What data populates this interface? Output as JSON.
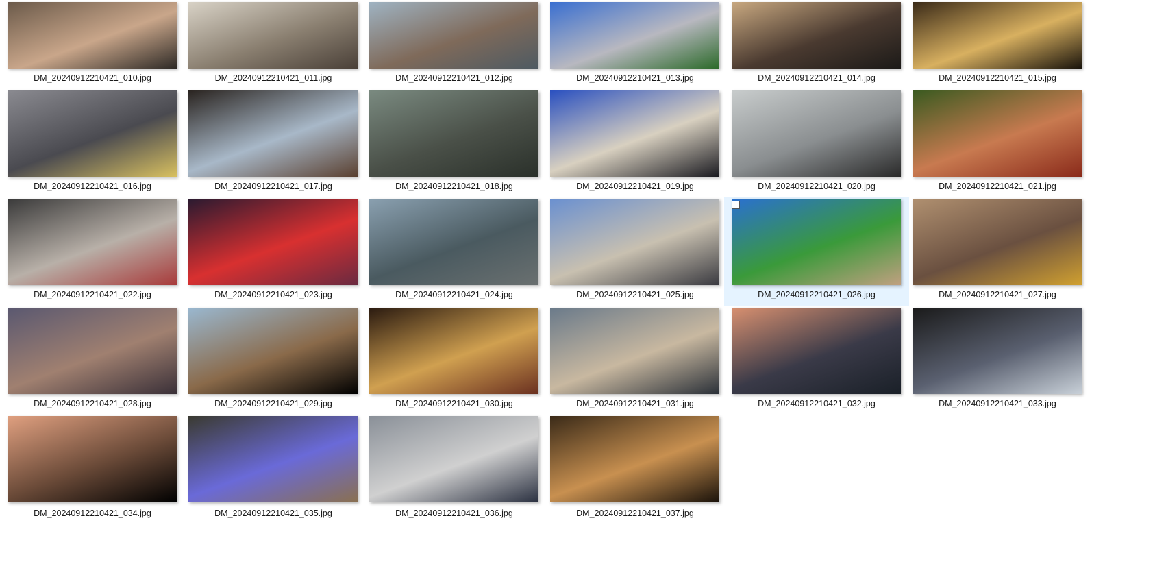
{
  "view": "explorer-large-icons",
  "hovered_index": 16,
  "thumbnail_icon": "image-thumbnail-icon",
  "files": [
    {
      "name": "DM_20240912210421_010.jpg",
      "colors": [
        "#6b5a4a",
        "#c9a68a",
        "#2e2a26"
      ]
    },
    {
      "name": "DM_20240912210421_011.jpg",
      "colors": [
        "#d8d2c6",
        "#8a7f70",
        "#4a4038"
      ]
    },
    {
      "name": "DM_20240912210421_012.jpg",
      "colors": [
        "#9fb3c2",
        "#7f6a5a",
        "#4e5a62"
      ]
    },
    {
      "name": "DM_20240912210421_013.jpg",
      "colors": [
        "#3a6fd0",
        "#b8b8c0",
        "#2c6a2a"
      ]
    },
    {
      "name": "DM_20240912210421_014.jpg",
      "colors": [
        "#c8a880",
        "#4a3a30",
        "#1c1a18"
      ]
    },
    {
      "name": "DM_20240912210421_015.jpg",
      "colors": [
        "#3a2a18",
        "#d8b060",
        "#1a140c"
      ]
    },
    {
      "name": "DM_20240912210421_016.jpg",
      "colors": [
        "#8a8a90",
        "#4a4a50",
        "#d8c060"
      ]
    },
    {
      "name": "DM_20240912210421_017.jpg",
      "colors": [
        "#2a2420",
        "#a8b8c8",
        "#5a4030"
      ]
    },
    {
      "name": "DM_20240912210421_018.jpg",
      "colors": [
        "#7a8a80",
        "#4a5048",
        "#2a302a"
      ]
    },
    {
      "name": "DM_20240912210421_019.jpg",
      "colors": [
        "#2a50c0",
        "#d8d0c0",
        "#1a1a20"
      ]
    },
    {
      "name": "DM_20240912210421_020.jpg",
      "colors": [
        "#c8cccc",
        "#8a8e90",
        "#2a2a2a"
      ]
    },
    {
      "name": "DM_20240912210421_021.jpg",
      "colors": [
        "#3a5a20",
        "#c87a50",
        "#8a2a1a"
      ]
    },
    {
      "name": "DM_20240912210421_022.jpg",
      "colors": [
        "#3a3a3a",
        "#b8b0a8",
        "#a83a3a"
      ]
    },
    {
      "name": "DM_20240912210421_023.jpg",
      "colors": [
        "#2a1a30",
        "#d83030",
        "#6a2a40"
      ]
    },
    {
      "name": "DM_20240912210421_024.jpg",
      "colors": [
        "#8aa0b0",
        "#4a5a60",
        "#6a7070"
      ]
    },
    {
      "name": "DM_20240912210421_025.jpg",
      "colors": [
        "#6a90d0",
        "#c8c0b0",
        "#3a3a40"
      ]
    },
    {
      "name": "DM_20240912210421_026.jpg",
      "colors": [
        "#2a70d0",
        "#3a9a3a",
        "#c0a080"
      ]
    },
    {
      "name": "DM_20240912210421_027.jpg",
      "colors": [
        "#b09070",
        "#6a5040",
        "#d0a030"
      ]
    },
    {
      "name": "DM_20240912210421_028.jpg",
      "colors": [
        "#5a5870",
        "#a08070",
        "#3a3038"
      ]
    },
    {
      "name": "DM_20240912210421_029.jpg",
      "colors": [
        "#9ab8d0",
        "#8a6a4a",
        "#000000"
      ]
    },
    {
      "name": "DM_20240912210421_030.jpg",
      "colors": [
        "#2a1a10",
        "#d0a050",
        "#6a3020"
      ]
    },
    {
      "name": "DM_20240912210421_031.jpg",
      "colors": [
        "#6a7a8a",
        "#c8b8a0",
        "#2a3038"
      ]
    },
    {
      "name": "DM_20240912210421_032.jpg",
      "colors": [
        "#d89070",
        "#3a3a48",
        "#1a2028"
      ]
    },
    {
      "name": "DM_20240912210421_033.jpg",
      "colors": [
        "#1a1a1a",
        "#5a6070",
        "#c8d0d8"
      ]
    },
    {
      "name": "DM_20240912210421_034.jpg",
      "colors": [
        "#e0a080",
        "#6a4a38",
        "#000000"
      ]
    },
    {
      "name": "DM_20240912210421_035.jpg",
      "colors": [
        "#3a3a30",
        "#6a6ad8",
        "#8a7050"
      ]
    },
    {
      "name": "DM_20240912210421_036.jpg",
      "colors": [
        "#8a9098",
        "#d0d0d0",
        "#2a3040"
      ]
    },
    {
      "name": "DM_20240912210421_037.jpg",
      "colors": [
        "#3a2a18",
        "#c89050",
        "#1a120a"
      ]
    }
  ]
}
